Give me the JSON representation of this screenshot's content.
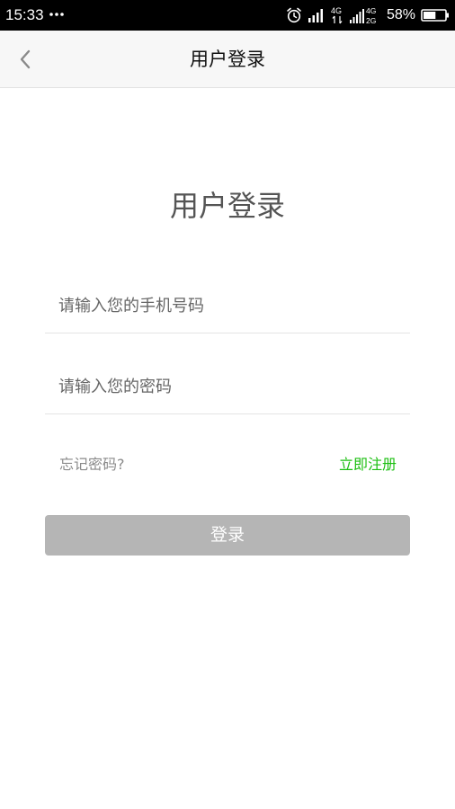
{
  "status_bar": {
    "time": "15:33",
    "battery_percent_text": "58%",
    "battery_level": 0.58,
    "network_primary": "4G",
    "network_secondary_top": "4G",
    "network_secondary_bottom": "2G",
    "icons": [
      "more-dots-icon",
      "alarm-icon",
      "signal-icon",
      "signal-icon-2",
      "battery-icon"
    ]
  },
  "nav": {
    "title": "用户登录",
    "back_icon": "chevron-left-icon"
  },
  "main": {
    "heading": "用户登录",
    "phone_placeholder": "请输入您的手机号码",
    "password_placeholder": "请输入您的密码",
    "forgot_label": "忘记密码?",
    "register_label": "立即注册",
    "login_label": "登录"
  },
  "colors": {
    "accent_green": "#1cbf12",
    "button_disabled": "#b5b5b5",
    "nav_background": "#f7f7f7"
  }
}
